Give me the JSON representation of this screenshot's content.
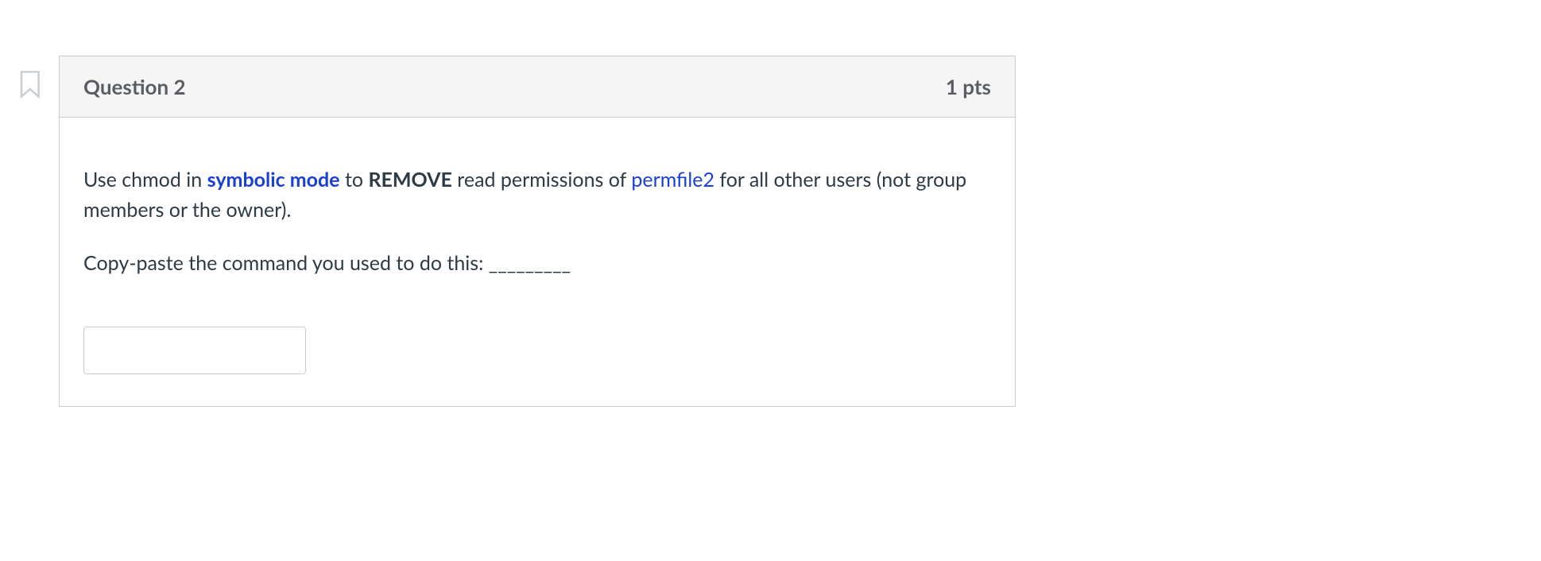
{
  "question": {
    "title": "Question 2",
    "points": "1 pts",
    "text_part1": "Use chmod in ",
    "text_symbolic_mode": "symbolic mode",
    "text_part2": " to ",
    "text_remove": "REMOVE",
    "text_part3": " read permissions of ",
    "text_permfile": "permfile2",
    "text_part4": " for all other users (not group members or the owner).",
    "prompt": "Copy-paste the command you used to do this: _________",
    "answer_value": ""
  }
}
